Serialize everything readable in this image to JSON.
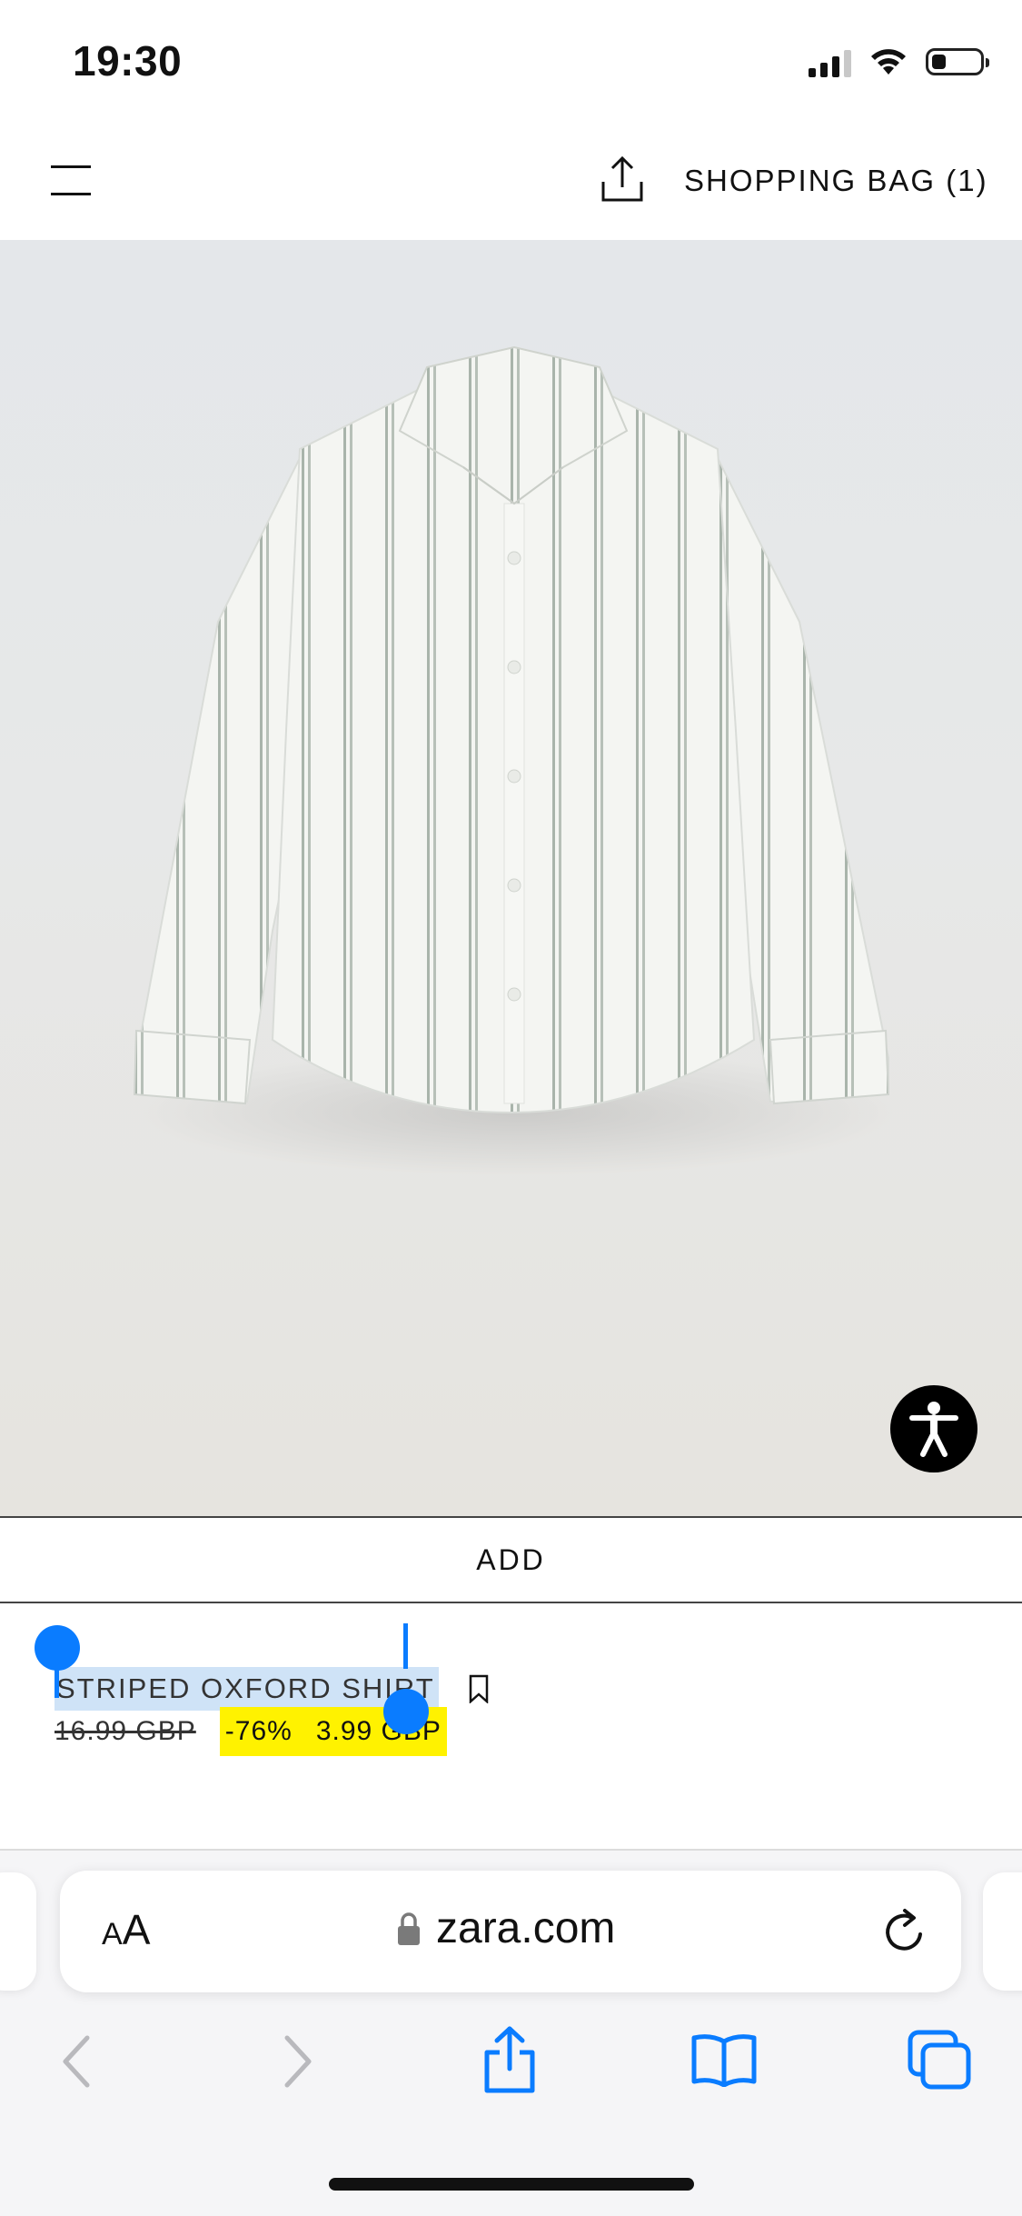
{
  "status_bar": {
    "time": "19:30",
    "icons": [
      "cellular-signal-icon",
      "wifi-icon",
      "battery-icon"
    ],
    "battery_level": 0.3
  },
  "header": {
    "menu_icon": "hamburger-menu-icon",
    "share_icon": "share-icon",
    "bag_label": "SHOPPING BAG (1)"
  },
  "product": {
    "image_icon": "shirt-image",
    "accessibility_icon": "accessibility-icon",
    "add_label": "ADD",
    "name": "STRIPED OXFORD SHIRT",
    "bookmark_icon": "bookmark-icon",
    "old_price": "16.99 GBP",
    "discount": "-76%",
    "new_price": "3.99 GBP"
  },
  "safari": {
    "text_size_label_small": "A",
    "text_size_label_large": "A",
    "url": "zara.com",
    "toolbar": [
      "back-icon",
      "forward-icon",
      "share-icon",
      "bookmarks-icon",
      "tabs-icon"
    ]
  },
  "colors": {
    "selection": "#cfe3f7",
    "selection_handle": "#0a7cff",
    "sale_highlight": "#fff200",
    "safari_blue": "#0a7cff"
  }
}
